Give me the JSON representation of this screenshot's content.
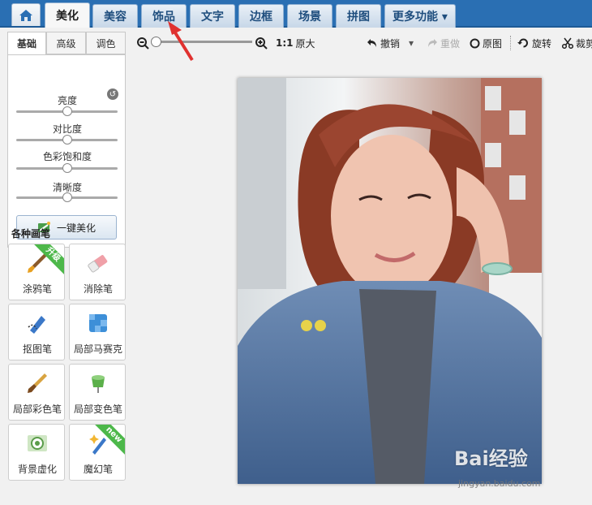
{
  "nav": {
    "home_icon": "home-icon",
    "tabs": [
      {
        "label": "美化",
        "active": true
      },
      {
        "label": "美容",
        "active": false
      },
      {
        "label": "饰品",
        "active": false
      },
      {
        "label": "文字",
        "active": false
      },
      {
        "label": "边框",
        "active": false
      },
      {
        "label": "场景",
        "active": false
      },
      {
        "label": "拼图",
        "active": false
      },
      {
        "label": "更多功能 ▾",
        "active": false
      }
    ]
  },
  "subtabs": [
    {
      "label": "基础",
      "active": true
    },
    {
      "label": "高级",
      "active": false
    },
    {
      "label": "调色",
      "active": false
    }
  ],
  "adjust": {
    "sliders": [
      {
        "label": "亮度",
        "value": 0.5
      },
      {
        "label": "对比度",
        "value": 0.5
      },
      {
        "label": "色彩饱和度",
        "value": 0.5
      },
      {
        "label": "清晰度",
        "value": 0.5
      }
    ],
    "beautify_label": "一键美化"
  },
  "brushes": {
    "title": "各种画笔",
    "items": [
      {
        "label": "涂鸦笔",
        "badge": "升级"
      },
      {
        "label": "消除笔",
        "badge": ""
      },
      {
        "label": "抠图笔",
        "badge": ""
      },
      {
        "label": "局部马赛克",
        "badge": ""
      },
      {
        "label": "局部彩色笔",
        "badge": ""
      },
      {
        "label": "局部变色笔",
        "badge": ""
      },
      {
        "label": "背景虚化",
        "badge": ""
      },
      {
        "label": "魔幻笔",
        "badge": "new"
      }
    ]
  },
  "toolbar": {
    "zoom_value": 0.05,
    "ratio_label": "1:1",
    "original_size": "原大",
    "undo": "撤销",
    "redo": "重做",
    "original": "原图",
    "rotate": "旋转",
    "crop": "裁剪"
  },
  "watermark": {
    "brand": "Bai经验",
    "url": "jingyan.baidu.com"
  },
  "colors": {
    "nav_bg": "#2a6fb3",
    "badge_green": "#4db84a",
    "arrow_red": "#e0312f"
  }
}
